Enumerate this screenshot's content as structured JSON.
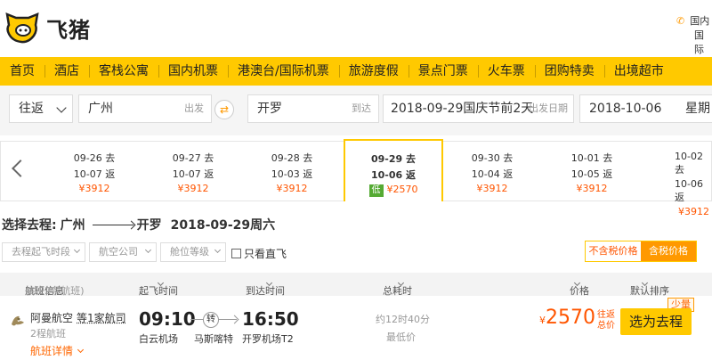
{
  "header": {
    "logo_text": "飞猪",
    "right_line1": "国内",
    "right_line2": "国际"
  },
  "nav": [
    "首页",
    "酒店",
    "客栈公寓",
    "国内机票",
    "港澳台/国际机票",
    "旅游度假",
    "景点门票",
    "火车票",
    "团购特卖",
    "出境超市"
  ],
  "search": {
    "trip_type": "往返",
    "from_city": "广州",
    "from_hint": "出发",
    "swap_label": "⇄",
    "to_city": "开罗",
    "to_hint": "到达",
    "depart_date": "2018-09-29国庆节前2天",
    "depart_hint": "出发日期",
    "return_date": "2018-10-06",
    "return_weekday": "星期"
  },
  "date_strip": [
    {
      "go": "09-26 去",
      "ret": "10-07 返",
      "price": "¥3912"
    },
    {
      "go": "09-27 去",
      "ret": "10-07 返",
      "price": "¥3912"
    },
    {
      "go": "09-28 去",
      "ret": "10-03 返",
      "price": "¥3912"
    },
    {
      "go": "09-29 去",
      "ret": "10-06 返",
      "price": "¥2570",
      "low": "低",
      "selected": true
    },
    {
      "go": "09-30 去",
      "ret": "10-04 返",
      "price": "¥3912"
    },
    {
      "go": "10-01 去",
      "ret": "10-05 返",
      "price": "¥3912"
    },
    {
      "go": "10-02 去",
      "ret": "10-06 返",
      "price": "¥3912"
    }
  ],
  "route": {
    "prefix": "选择去程:",
    "from": "广州",
    "to": "开罗",
    "date": "2018-09-29周六"
  },
  "filters": {
    "depart_time": "去程起飞时段",
    "airline": "航空公司",
    "cabin": "舱位等级",
    "direct_only": "只看直飞",
    "exclude_tax": "不含税价格",
    "include_tax": "含税价格"
  },
  "list_header": {
    "info": "航班信息",
    "count": "(共22条航班)",
    "depart": "起飞时间",
    "arrive": "到达时间",
    "duration": "总耗时",
    "price": "价格",
    "sort": "默认排序"
  },
  "flight": {
    "airline": "阿曼航空",
    "plus": "等1家航司",
    "legs": "2程航班",
    "details": "航班详情",
    "dep_time": "09:10",
    "dep_airport": "白云机场",
    "stop_badge": "转",
    "stop_city": "马斯喀特",
    "arr_time": "16:50",
    "arr_airport": "开罗机场T2",
    "duration": "约12时40分",
    "lowest": "最低价",
    "currency": "¥",
    "price": "2570",
    "tax_note": "往返总价",
    "badge": "少量",
    "book_label": "选为去程"
  },
  "colors": {
    "brand_yellow": "#ffc900",
    "price_orange": "#ff5500",
    "accent_orange": "#ff9900"
  }
}
